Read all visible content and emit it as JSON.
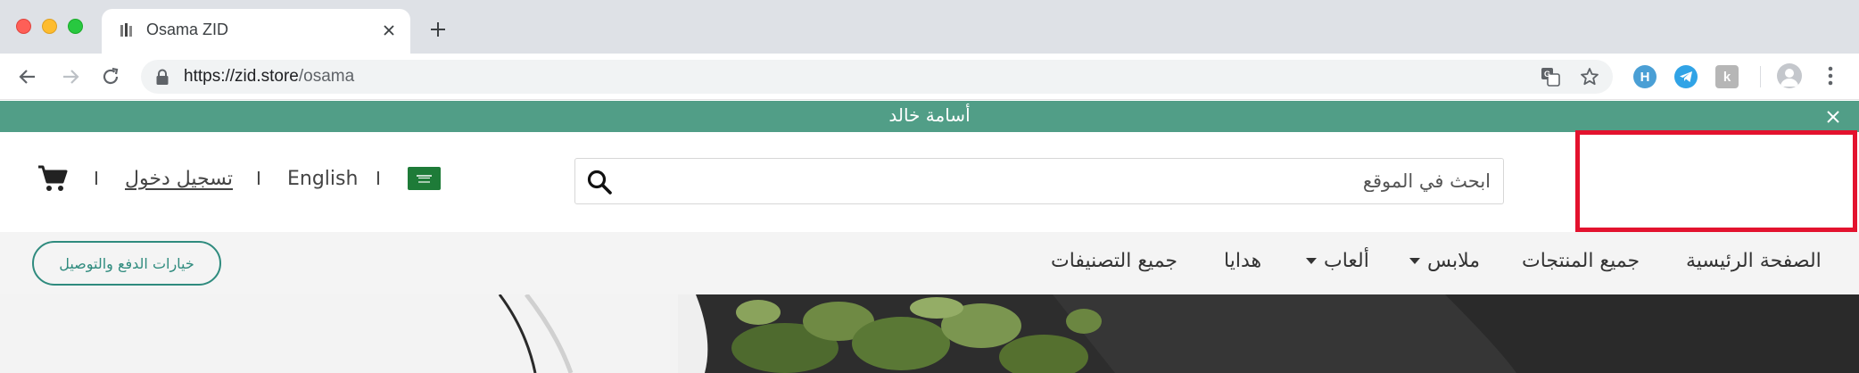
{
  "browser": {
    "tab_title": "Osama ZID",
    "url_host": "https://zid.store",
    "url_path": "/osama",
    "extensions": [
      {
        "name": "honey-extension",
        "letter": "H",
        "color": "#4a9fd5"
      },
      {
        "name": "telegram-extension",
        "letter": "",
        "color": "#30a3e6"
      },
      {
        "name": "k-extension",
        "letter": "k",
        "color": "#b6b6b6"
      }
    ]
  },
  "announcement": {
    "text": "أسامة خالد"
  },
  "header": {
    "search_placeholder": "ابحث في الموقع",
    "language_label": "English",
    "login_label": "تسجيل دخول",
    "separator": "I",
    "flag_color": "#1e7b38"
  },
  "nav": {
    "items": [
      {
        "label": "الصفحة الرئيسية",
        "dropdown": false
      },
      {
        "label": "جميع المنتجات",
        "dropdown": false
      },
      {
        "label": "ملابس",
        "dropdown": true
      },
      {
        "label": "ألعاب",
        "dropdown": true
      },
      {
        "label": "هدايا",
        "dropdown": false
      },
      {
        "label": "جميع التصنيفات",
        "dropdown": false
      }
    ],
    "payment_button_label": "خيارات الدفع والتوصيل"
  },
  "colors": {
    "brand": "#519e87",
    "accent": "#2f8b7e",
    "highlight": "#e3122e"
  }
}
